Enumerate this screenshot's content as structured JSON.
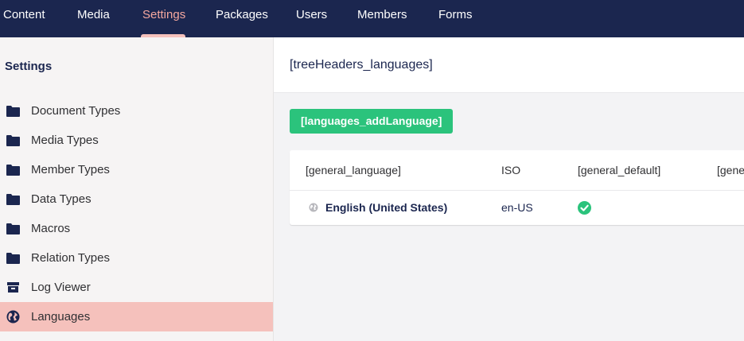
{
  "topnav": {
    "items": [
      {
        "label": "Content"
      },
      {
        "label": "Media"
      },
      {
        "label": "Settings"
      },
      {
        "label": "Packages"
      },
      {
        "label": "Users"
      },
      {
        "label": "Members"
      },
      {
        "label": "Forms"
      }
    ],
    "active": "Settings"
  },
  "sidebar": {
    "title": "Settings",
    "items": [
      {
        "label": "Document Types",
        "icon": "folder-icon"
      },
      {
        "label": "Media Types",
        "icon": "folder-icon"
      },
      {
        "label": "Member Types",
        "icon": "folder-icon"
      },
      {
        "label": "Data Types",
        "icon": "folder-icon"
      },
      {
        "label": "Macros",
        "icon": "folder-icon"
      },
      {
        "label": "Relation Types",
        "icon": "folder-icon"
      },
      {
        "label": "Log Viewer",
        "icon": "archive-icon"
      },
      {
        "label": "Languages",
        "icon": "globe-icon"
      }
    ],
    "active": "Languages"
  },
  "main": {
    "title": "[treeHeaders_languages]",
    "add_button": "[languages_addLanguage]",
    "table": {
      "headers": [
        "[general_language]",
        "ISO",
        "[general_default]",
        "[general_mandatory]"
      ],
      "rows": [
        {
          "language": "English (United States)",
          "iso": "en-US",
          "default": true
        }
      ]
    }
  },
  "colors": {
    "nav_bg": "#1b264f",
    "active_nav_text": "#f5a89f",
    "active_item_bg": "#f5c1bc",
    "add_button_bg": "#2bc37c",
    "check_green": "#2bc37c"
  }
}
